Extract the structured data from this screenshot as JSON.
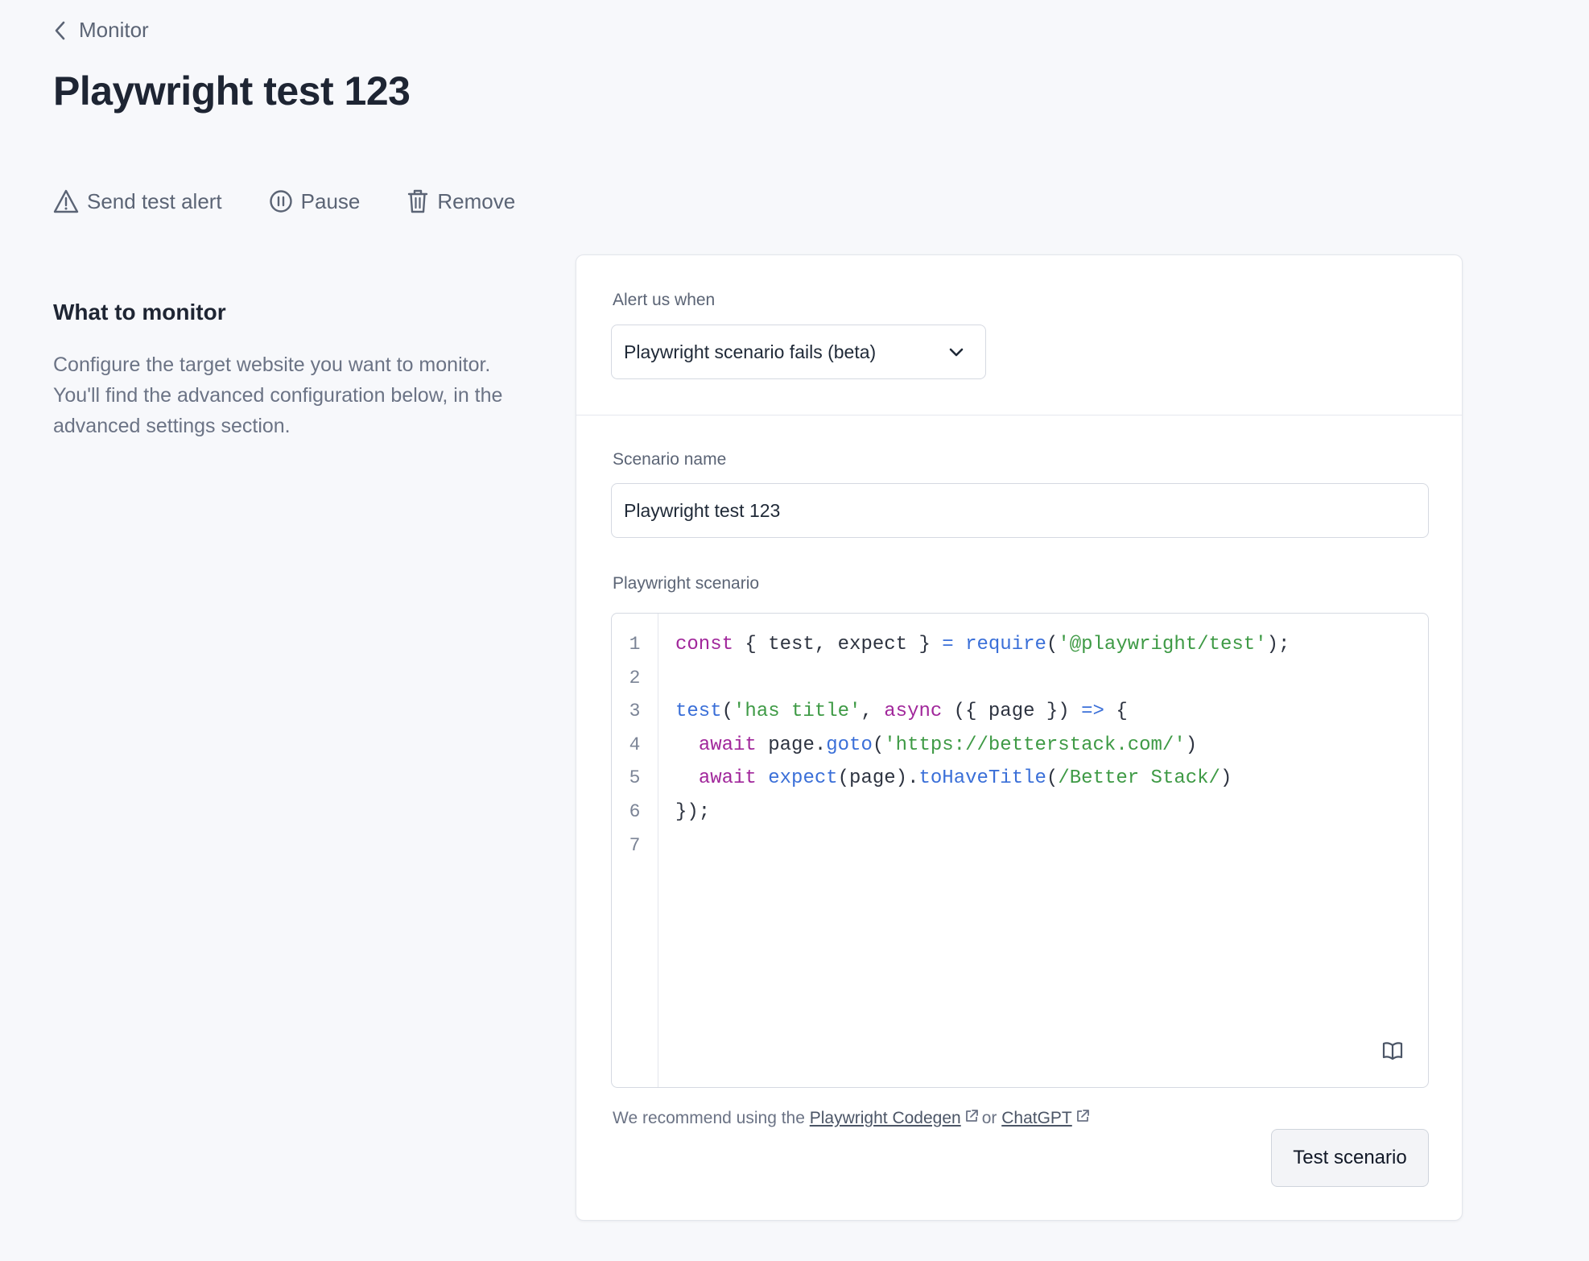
{
  "breadcrumb": {
    "label": "Monitor"
  },
  "page": {
    "title": "Playwright test 123"
  },
  "actions": {
    "send_test_alert": "Send test alert",
    "pause": "Pause",
    "remove": "Remove"
  },
  "section": {
    "heading": "What to monitor",
    "description": "Configure the target website you want to monitor. You'll find the advanced configuration below, in the advanced settings section."
  },
  "form": {
    "alert_label": "Alert us when",
    "alert_value": "Playwright scenario fails (beta)",
    "scenario_name_label": "Scenario name",
    "scenario_name_value": "Playwright test 123",
    "scenario_label": "Playwright scenario",
    "recommend_prefix": "We recommend using the",
    "recommend_link_codegen": "Playwright Codegen",
    "recommend_or": "or",
    "recommend_link_chatgpt": "ChatGPT",
    "test_button": "Test scenario"
  },
  "code": {
    "line_numbers": [
      "1",
      "2",
      "3",
      "4",
      "5",
      "6",
      "7"
    ],
    "lines": [
      [
        [
          "kw",
          "const"
        ],
        [
          "plain",
          " { test, expect } "
        ],
        [
          "op",
          "="
        ],
        [
          "plain",
          " "
        ],
        [
          "fn",
          "require"
        ],
        [
          "plain",
          "("
        ],
        [
          "str",
          "'@playwright/test'"
        ],
        [
          "plain",
          ");"
        ]
      ],
      [],
      [
        [
          "fn",
          "test"
        ],
        [
          "plain",
          "("
        ],
        [
          "str",
          "'has title'"
        ],
        [
          "plain",
          ", "
        ],
        [
          "kw",
          "async"
        ],
        [
          "plain",
          " ({ page }) "
        ],
        [
          "op",
          "=>"
        ],
        [
          "plain",
          " {"
        ]
      ],
      [
        [
          "plain",
          "  "
        ],
        [
          "kw",
          "await"
        ],
        [
          "plain",
          " page."
        ],
        [
          "fn",
          "goto"
        ],
        [
          "plain",
          "("
        ],
        [
          "str",
          "'https://betterstack.com/'"
        ],
        [
          "plain",
          ")"
        ]
      ],
      [
        [
          "plain",
          "  "
        ],
        [
          "kw",
          "await"
        ],
        [
          "plain",
          " "
        ],
        [
          "fn",
          "expect"
        ],
        [
          "plain",
          "(page)."
        ],
        [
          "fn",
          "toHaveTitle"
        ],
        [
          "plain",
          "("
        ],
        [
          "str",
          "/Better Stack/"
        ],
        [
          "plain",
          ")"
        ]
      ],
      [
        [
          "plain",
          "});"
        ]
      ],
      []
    ]
  },
  "icons": {
    "back": "chevron-left-icon",
    "alert": "warning-triangle-icon",
    "pause": "pause-circle-icon",
    "remove": "trash-icon",
    "dropdown": "chevron-down-icon",
    "docs": "book-icon",
    "external": "external-link-icon"
  },
  "colors": {
    "background": "#f7f8fb",
    "keyword": "#a1279b",
    "function": "#3a6fd8",
    "string": "#3e9a45"
  }
}
